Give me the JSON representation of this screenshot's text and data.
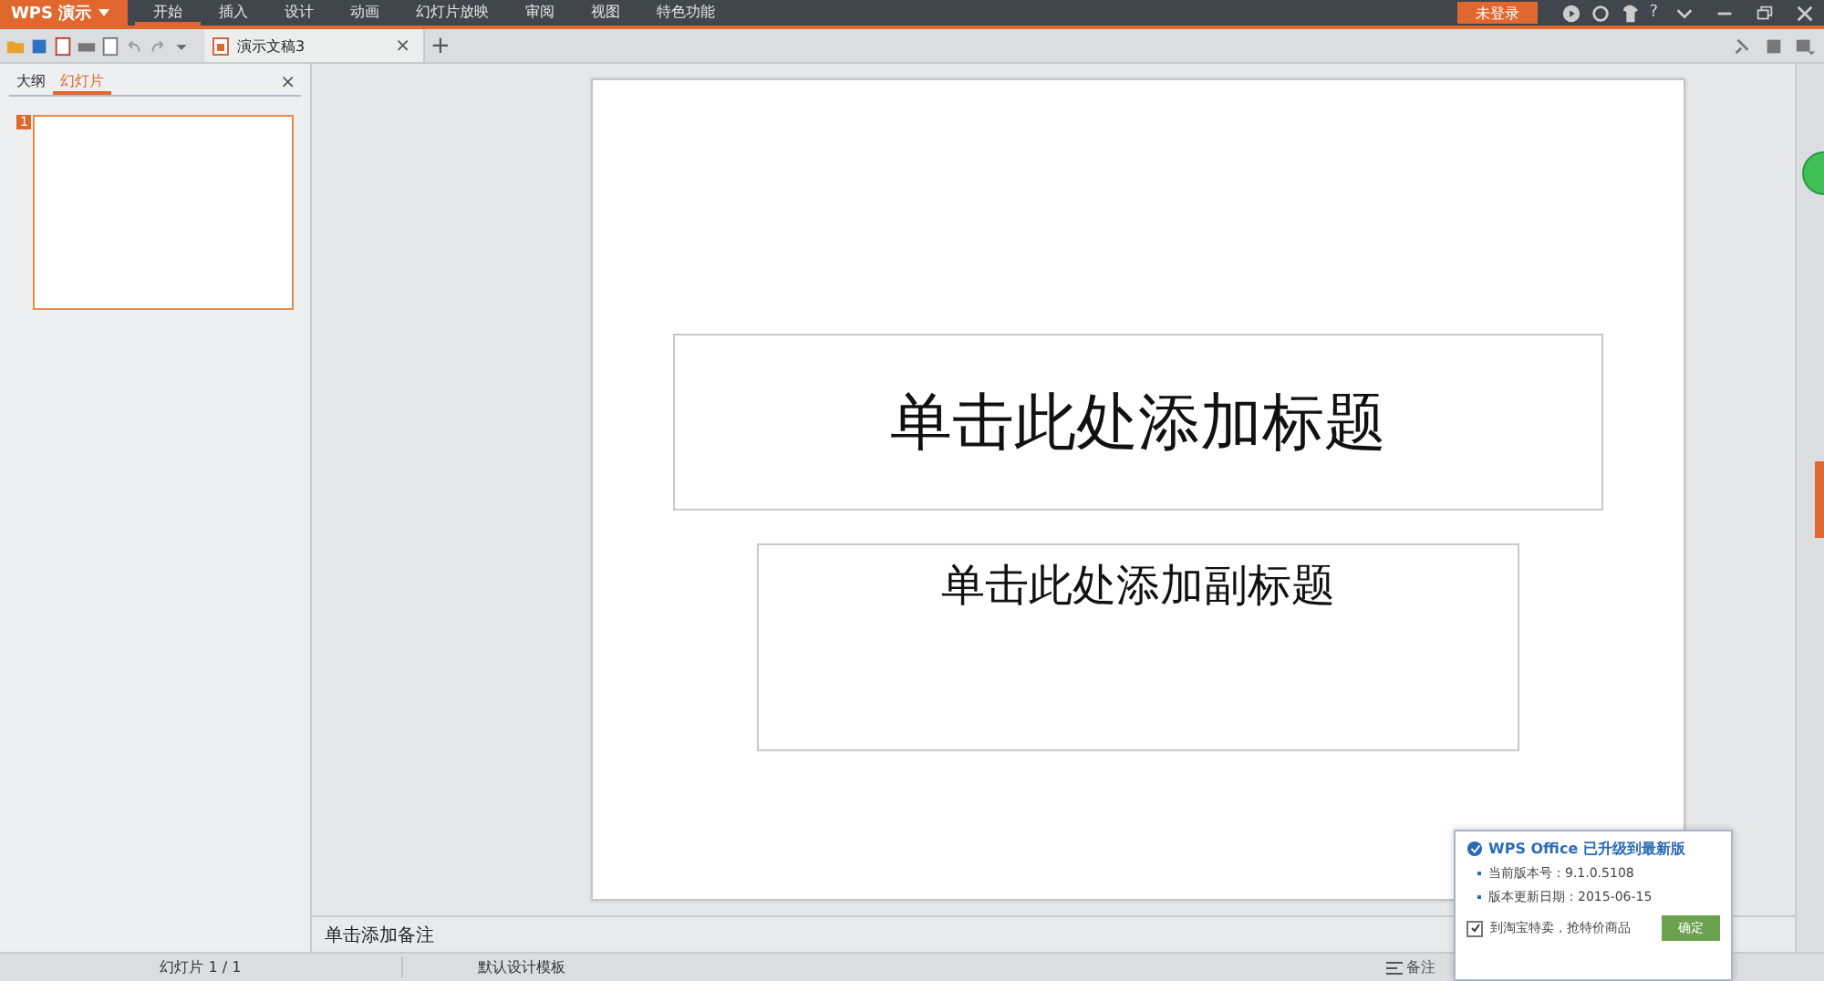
{
  "app_menu": {
    "label": "WPS 演示"
  },
  "menu_tabs": [
    {
      "label": "开始",
      "selected": true
    },
    {
      "label": "插入",
      "selected": false
    },
    {
      "label": "设计",
      "selected": false
    },
    {
      "label": "动画",
      "selected": false
    },
    {
      "label": "幻灯片放映",
      "selected": false
    },
    {
      "label": "审阅",
      "selected": false
    },
    {
      "label": "视图",
      "selected": false
    },
    {
      "label": "特色功能",
      "selected": false
    }
  ],
  "login_button": "未登录",
  "help_button": "?",
  "document_tab": {
    "title": "演示文稿3",
    "close": "×",
    "new_tab": "+"
  },
  "side_panel": {
    "tabs": [
      {
        "label": "大纲",
        "selected": false
      },
      {
        "label": "幻灯片",
        "selected": true
      }
    ],
    "close": "×",
    "thumbnails": [
      {
        "number": "1",
        "selected": true
      }
    ]
  },
  "slide": {
    "title_placeholder": "单击此处添加标题",
    "subtitle_placeholder": "单击此处添加副标题"
  },
  "notes_placeholder": "单击添加备注",
  "status_bar": {
    "slide_counter": "幻灯片 1 / 1",
    "template": "默认设计模板",
    "notes_button": "备注"
  },
  "update_popup": {
    "title": "WPS Office 已升级到最新版",
    "lines": [
      "当前版本号：9.1.0.5108",
      "版本更新日期：2015-06-15"
    ],
    "option": {
      "label": "到淘宝特卖，抢特价商品",
      "checked": true
    },
    "confirm": "确定"
  }
}
